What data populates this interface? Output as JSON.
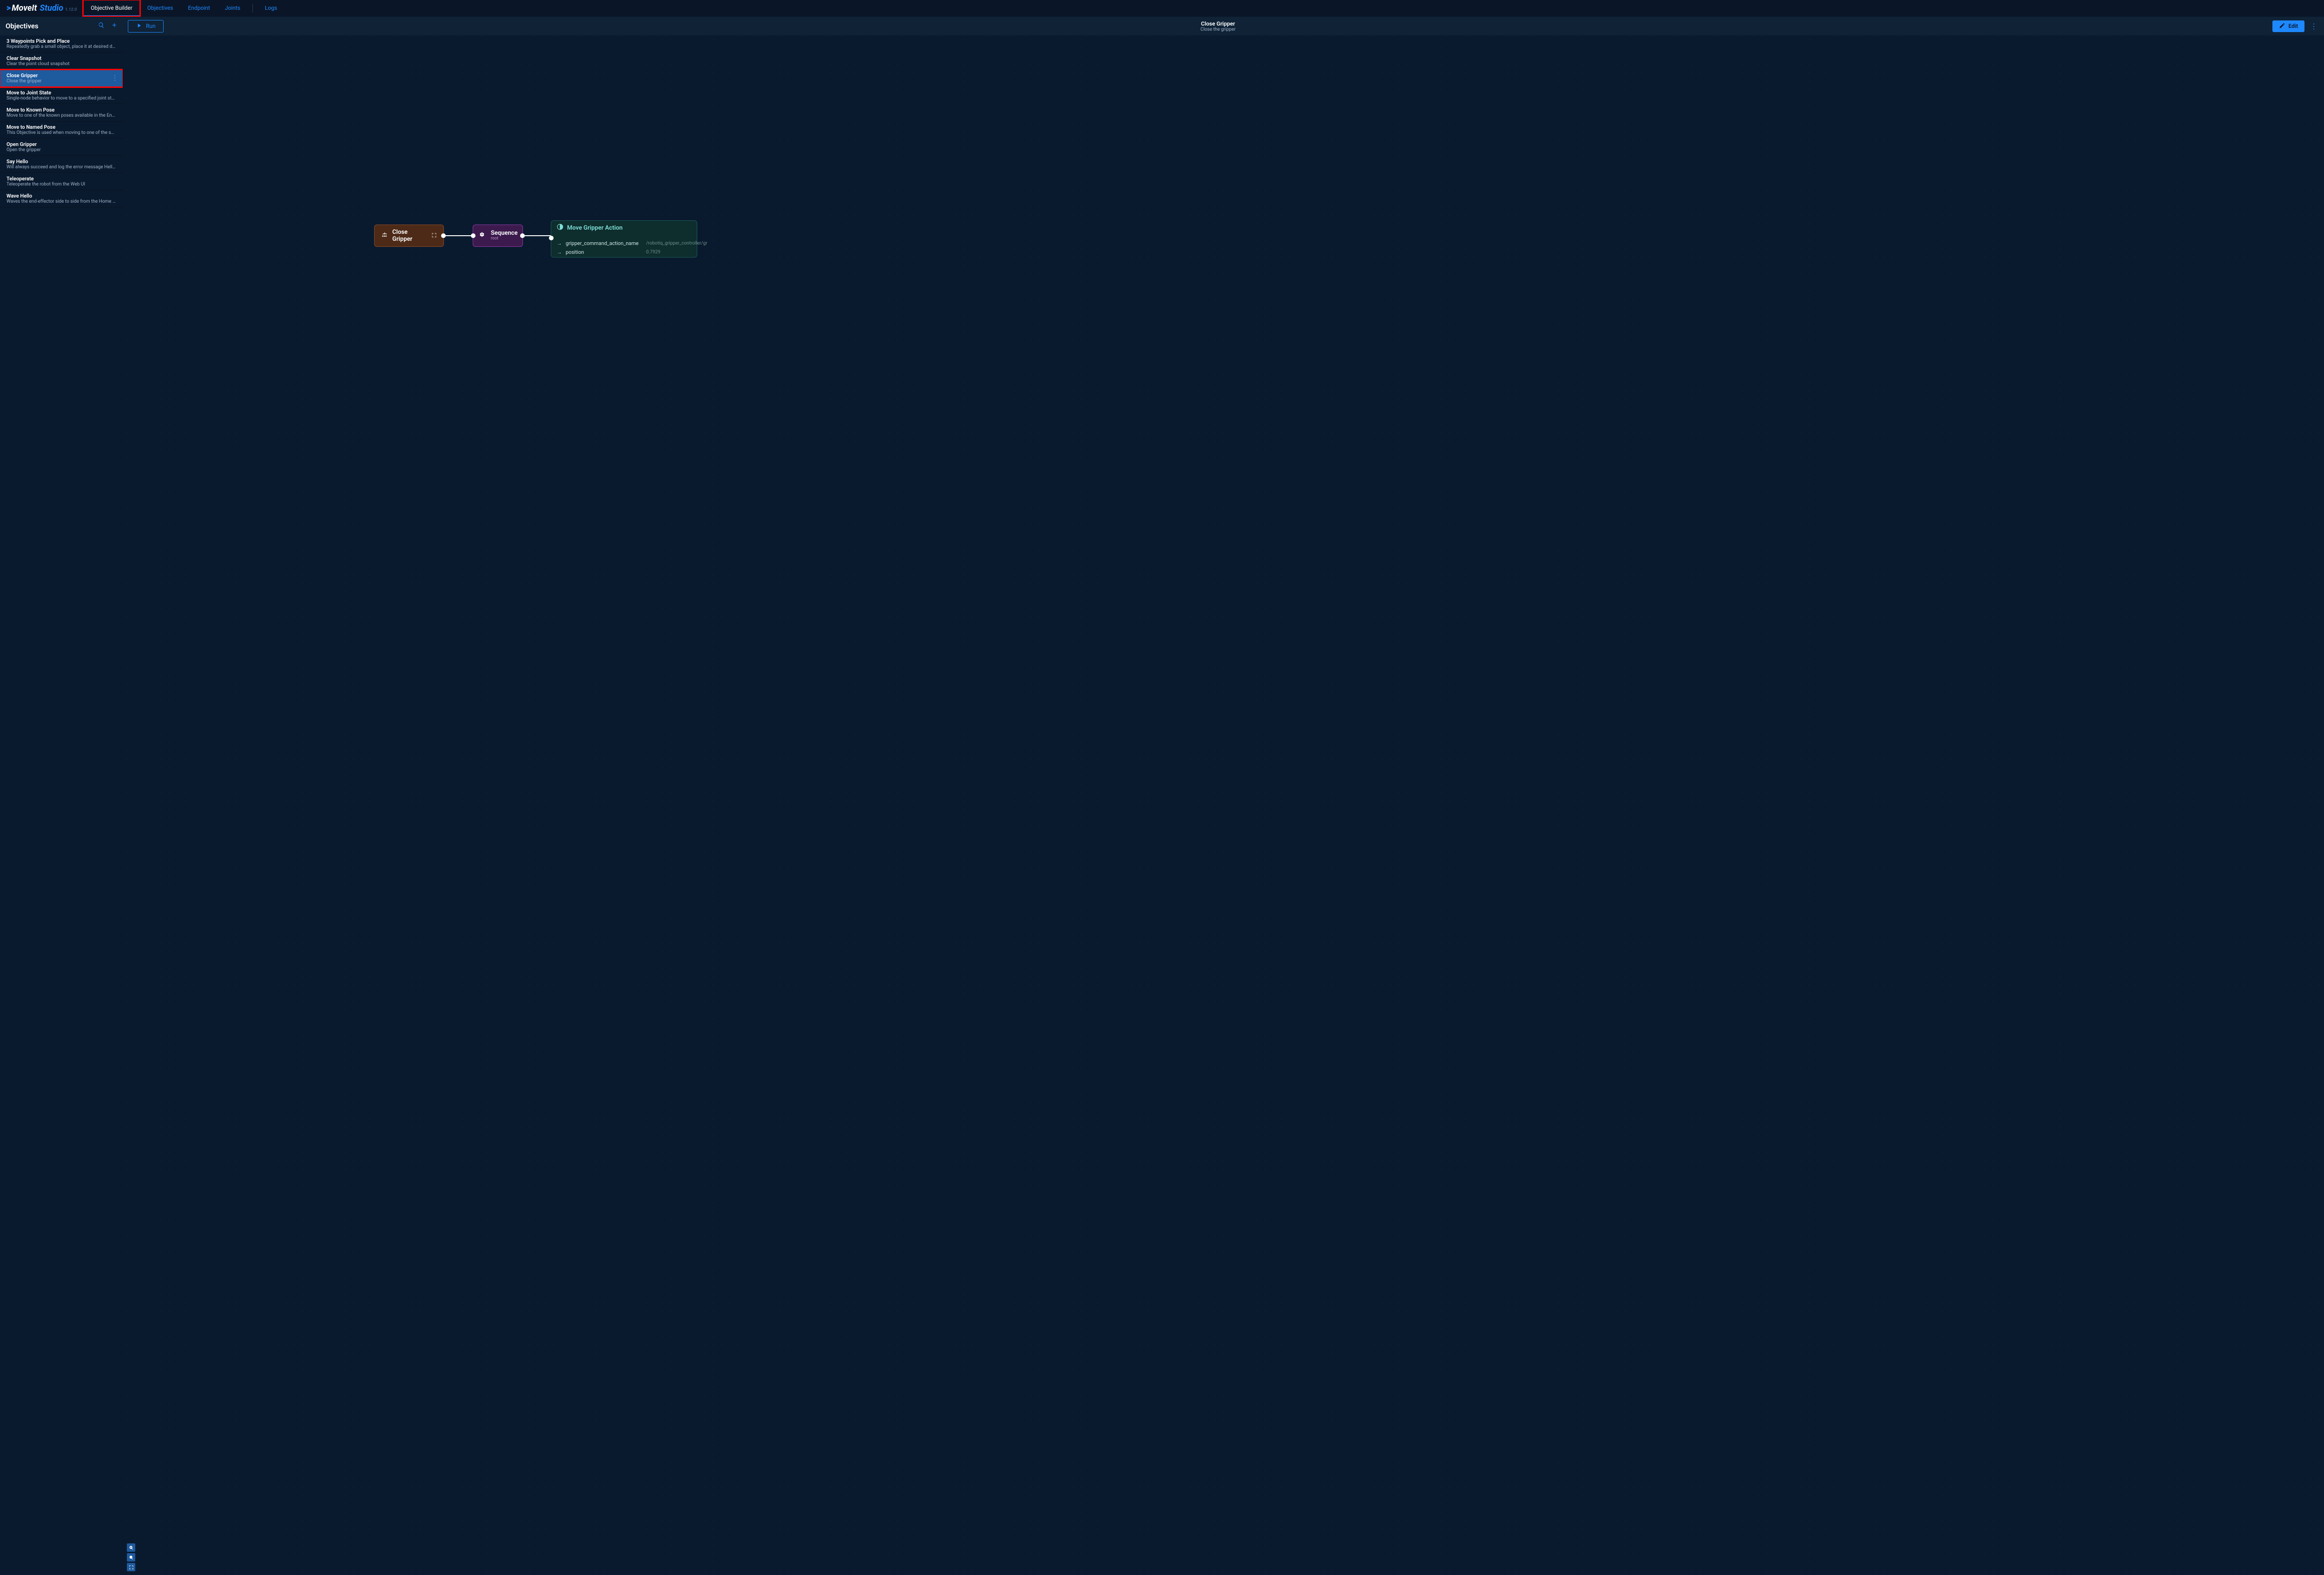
{
  "brand": {
    "moveit": "MoveIt",
    "studio": "Studio",
    "version": "1.12.0"
  },
  "nav": {
    "tabs": [
      {
        "label": "Objective Builder",
        "active": true,
        "highlight": true
      },
      {
        "label": "Objectives",
        "active": false,
        "highlight": false
      },
      {
        "label": "Endpoint",
        "active": false,
        "highlight": false
      },
      {
        "label": "Joints",
        "active": false,
        "highlight": false
      },
      {
        "label": "Logs",
        "active": false,
        "highlight": false
      }
    ]
  },
  "sidebar": {
    "heading": "Objectives",
    "items": [
      {
        "title": "3 Waypoints Pick and Place",
        "desc": "Repeatedly grab a small object, place it at desired destinatio…",
        "selected": false
      },
      {
        "title": "Clear Snapshot",
        "desc": "Clear the point cloud snapshot",
        "selected": false
      },
      {
        "title": "Close Gripper",
        "desc": "Close the gripper",
        "selected": true
      },
      {
        "title": "Move to Joint State",
        "desc": "Single-node behavior to move to a specified joint state",
        "selected": false
      },
      {
        "title": "Move to Known Pose",
        "desc": "Move to one of the known poses available in the Endpoint tab",
        "selected": false
      },
      {
        "title": "Move to Named Pose",
        "desc": "This Objective is used when moving to one of the saved way…",
        "selected": false
      },
      {
        "title": "Open Gripper",
        "desc": "Open the gripper",
        "selected": false
      },
      {
        "title": "Say Hello",
        "desc": "Will always succeed and log the error message Hello Woold!",
        "selected": false
      },
      {
        "title": "Teleoperate",
        "desc": "Teleoperate the robot from the Web UI",
        "selected": false
      },
      {
        "title": "Wave Hello",
        "desc": "Waves the end-effector side to side from the Home waypoint",
        "selected": false
      }
    ]
  },
  "canvas": {
    "run_label": "Run",
    "header_title": "Close Gripper",
    "header_subtitle": "Close the gripper",
    "edit_label": "Edit",
    "nodes": {
      "root": {
        "label": "Close Gripper"
      },
      "seq": {
        "label": "Sequence",
        "sub": "root"
      },
      "action": {
        "label": "Move Gripper Action",
        "params": [
          {
            "k": "gripper_command_action_name",
            "v": "/robotiq_gripper_controller/gr"
          },
          {
            "k": "position",
            "v": "0.7929"
          }
        ]
      }
    }
  }
}
